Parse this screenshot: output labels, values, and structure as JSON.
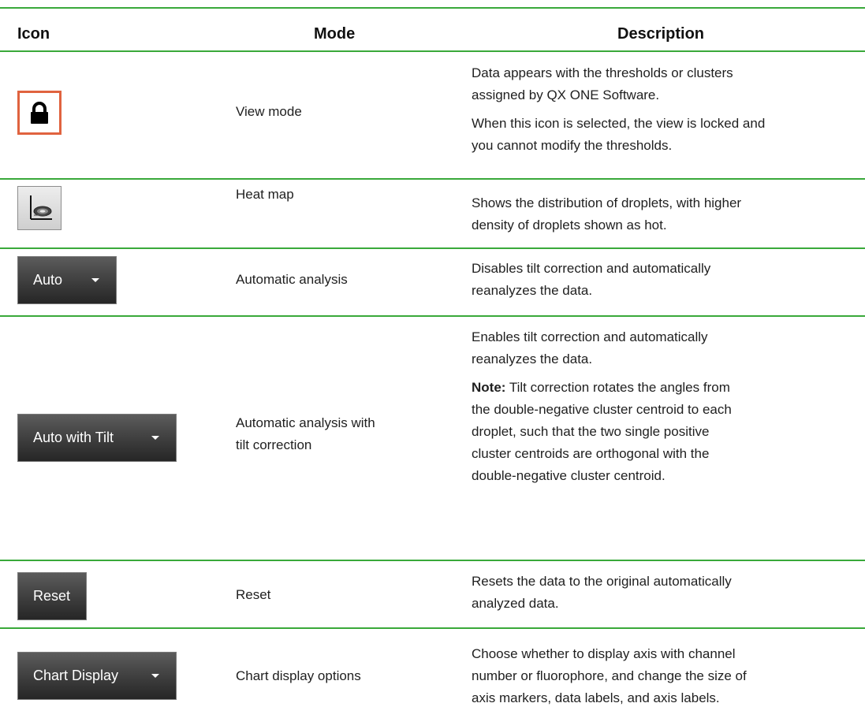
{
  "headers": {
    "icon": "Icon",
    "mode": "Mode",
    "description": "Description"
  },
  "rows": [
    {
      "icon": "lock-icon",
      "mode": "View mode",
      "description": [
        "Data appears with the thresholds or clusters",
        "assigned by QX ONE Software.",
        "When this icon is selected, the view is locked and",
        "you cannot modify the thresholds."
      ]
    },
    {
      "icon": "heat-map-icon",
      "mode": "Heat map",
      "description": [
        "Shows the distribution of droplets, with higher",
        "density of droplets shown as hot."
      ]
    },
    {
      "button_label": "Auto",
      "mode": "Automatic analysis",
      "description": [
        "Disables tilt correction and automatically",
        "reanalyzes the data."
      ]
    },
    {
      "button_label": "Auto with Tilt",
      "mode": [
        "Automatic analysis with",
        "tilt correction"
      ],
      "description": [
        "Enables tilt correction and automatically",
        "reanalyzes the data."
      ],
      "note_label": "Note:",
      "note": [
        " Tilt correction rotates the angles from",
        "the double-negative cluster centroid to each",
        "droplet, such that the two single positive",
        "cluster centroids are orthogonal with the",
        "double-negative cluster centroid."
      ]
    },
    {
      "button_label": "Reset",
      "mode": "Reset",
      "description": [
        "Resets the data to the original automatically",
        "analyzed data."
      ]
    },
    {
      "button_label": "Chart Display",
      "mode": "Chart display options",
      "description": [
        "Choose whether to display axis with channel",
        "number or fluorophore, and change the size of",
        "axis markers, data labels, and axis labels."
      ]
    }
  ],
  "colors": {
    "rule": "#39a93a",
    "lock_border": "#e0633f",
    "button_dark": "#3d3d3d"
  }
}
